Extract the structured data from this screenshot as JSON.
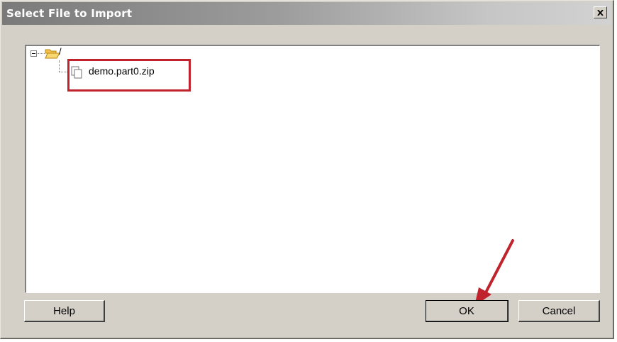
{
  "window": {
    "title": "Select File to Import",
    "close_label": "×"
  },
  "tree": {
    "root": {
      "label": "/",
      "icon": "open-folder-icon",
      "expanded": true
    },
    "children": [
      {
        "label": "demo.part0.zip",
        "icon": "file-copy-icon"
      }
    ]
  },
  "buttons": {
    "help": "Help",
    "ok": "OK",
    "cancel": "Cancel"
  },
  "annotations": {
    "highlight_color": "#c0232b",
    "arrow_color": "#c0232b"
  }
}
